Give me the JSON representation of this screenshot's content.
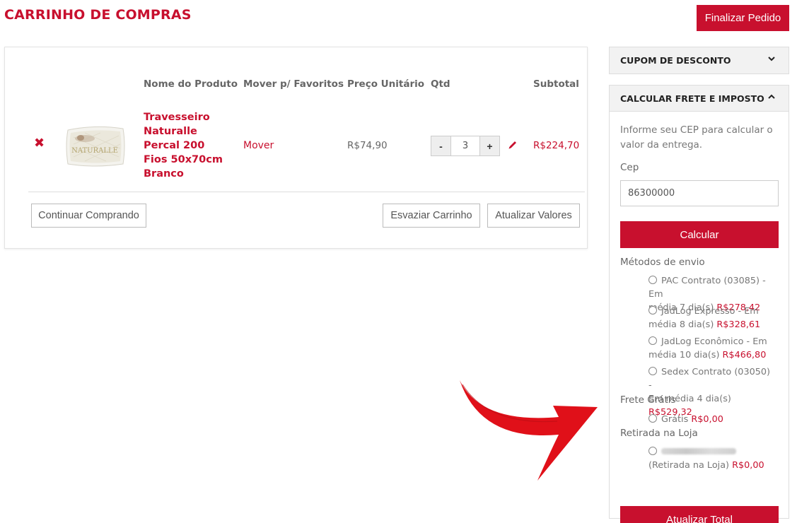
{
  "header": {
    "title": "CARRINHO DE COMPRAS",
    "finalize_label": "Finalizar Pedido"
  },
  "cart": {
    "columns": {
      "name": "Nome do Produto",
      "move": "Mover p/ Favoritos",
      "unit_price": "Preço Unitário",
      "qty": "Qtd",
      "subtotal": "Subtotal"
    },
    "item": {
      "name": "Travesseiro Naturalle Percal 200 Fios 50x70cm Branco",
      "thumb_text": "NATURALLE",
      "move_label": "Mover",
      "unit_price": "R$74,90",
      "qty": "3",
      "minus": "-",
      "plus": "+",
      "subtotal": "R$224,70"
    },
    "continue_label": "Continuar Comprando",
    "empty_label": "Esvaziar Carrinho",
    "update_label": "Atualizar Valores"
  },
  "coupon": {
    "title": "CUPOM DE DESCONTO"
  },
  "shipping": {
    "title": "CALCULAR FRETE E IMPOSTO",
    "info": "Informe seu CEP para calcular o valor da entrega.",
    "cep_label": "Cep",
    "cep_value": "86300000",
    "calc_label": "Calcular",
    "methods_label": "Métodos de envio",
    "methods": [
      {
        "line1": "PAC Contrato (03085) - Em",
        "line2": "média 7 dia(s)",
        "price": "R$278,42"
      },
      {
        "line1": "JadLog Expresso - Em",
        "line2": "média 8 dia(s)",
        "price": "R$328,61"
      },
      {
        "line1": "JadLog Econômico - Em",
        "line2": "média 10 dia(s)",
        "price": "R$466,80"
      },
      {
        "line1": "Sedex Contrato (03050) -",
        "line2": "Em média 4 dia(s)",
        "price": "R$529,32"
      }
    ],
    "free_label": "Frete Grátis",
    "free_option": {
      "name": "Grátis",
      "price": "R$0,00"
    },
    "pickup_label": "Retirada na Loja",
    "pickup_option": {
      "line2": "(Retirada na Loja)",
      "price": "R$0,00"
    },
    "update_total_label": "Atualizar Total"
  },
  "colors": {
    "accent": "#c8102e"
  }
}
